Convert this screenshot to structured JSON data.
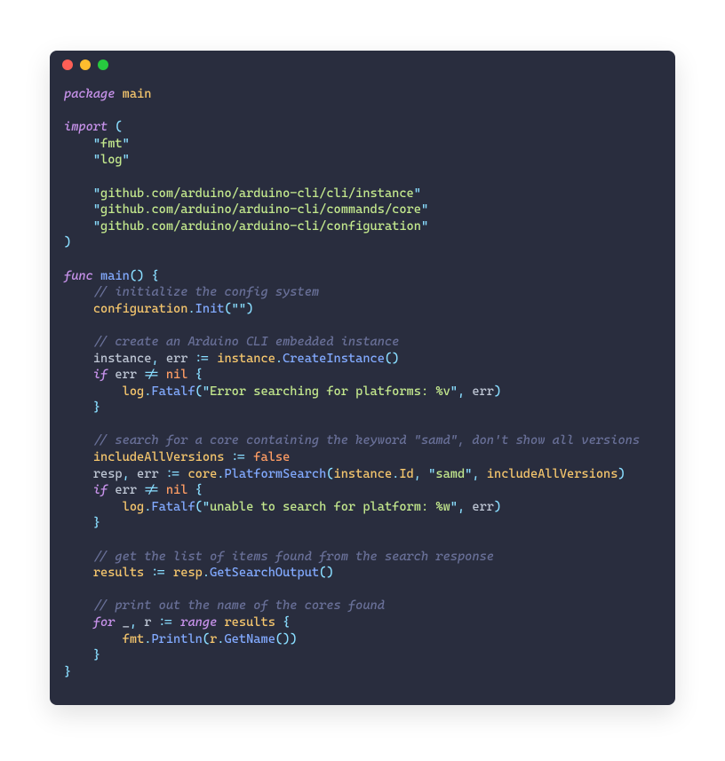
{
  "lines": [
    [
      [
        "kw-pkg",
        "package"
      ],
      [
        "white",
        " "
      ],
      [
        "ident",
        "main"
      ]
    ],
    [],
    [
      [
        "kw-pkg",
        "import"
      ],
      [
        "white",
        " "
      ],
      [
        "punc",
        "("
      ]
    ],
    [
      [
        "white",
        "    "
      ],
      [
        "strq",
        "\""
      ],
      [
        "str",
        "fmt"
      ],
      [
        "strq",
        "\""
      ]
    ],
    [
      [
        "white",
        "    "
      ],
      [
        "strq",
        "\""
      ],
      [
        "str",
        "log"
      ],
      [
        "strq",
        "\""
      ]
    ],
    [],
    [
      [
        "white",
        "    "
      ],
      [
        "strq",
        "\""
      ],
      [
        "str",
        "github.com/arduino/arduino-cli/cli/instance"
      ],
      [
        "strq",
        "\""
      ]
    ],
    [
      [
        "white",
        "    "
      ],
      [
        "strq",
        "\""
      ],
      [
        "str",
        "github.com/arduino/arduino-cli/commands/core"
      ],
      [
        "strq",
        "\""
      ]
    ],
    [
      [
        "white",
        "    "
      ],
      [
        "strq",
        "\""
      ],
      [
        "str",
        "github.com/arduino/arduino-cli/configuration"
      ],
      [
        "strq",
        "\""
      ]
    ],
    [
      [
        "punc",
        ")"
      ]
    ],
    [],
    [
      [
        "kw-pkg",
        "func"
      ],
      [
        "white",
        " "
      ],
      [
        "call",
        "main"
      ],
      [
        "punc",
        "()"
      ],
      [
        "white",
        " "
      ],
      [
        "punc",
        "{"
      ]
    ],
    [
      [
        "white",
        "    "
      ],
      [
        "comment",
        "// initialize the config system"
      ]
    ],
    [
      [
        "white",
        "    "
      ],
      [
        "ident",
        "configuration"
      ],
      [
        "punc",
        "."
      ],
      [
        "call",
        "Init"
      ],
      [
        "punc",
        "("
      ],
      [
        "strq",
        "\""
      ],
      [
        "strq",
        "\""
      ],
      [
        "punc",
        ")"
      ]
    ],
    [],
    [
      [
        "white",
        "    "
      ],
      [
        "comment",
        "// create an Arduino CLI embedded instance"
      ]
    ],
    [
      [
        "white",
        "    "
      ],
      [
        "varname",
        "instance"
      ],
      [
        "punc",
        ","
      ],
      [
        "white",
        " "
      ],
      [
        "varname",
        "err"
      ],
      [
        "white",
        " "
      ],
      [
        "punc",
        ":="
      ],
      [
        "white",
        " "
      ],
      [
        "ident",
        "instance"
      ],
      [
        "punc",
        "."
      ],
      [
        "call",
        "CreateInstance"
      ],
      [
        "punc",
        "()"
      ]
    ],
    [
      [
        "white",
        "    "
      ],
      [
        "kw-pkg",
        "if"
      ],
      [
        "white",
        " "
      ],
      [
        "varname",
        "err"
      ],
      [
        "white",
        " "
      ],
      [
        "punc",
        "!="
      ],
      [
        "white",
        " "
      ],
      [
        "const",
        "nil"
      ],
      [
        "white",
        " "
      ],
      [
        "punc",
        "{"
      ]
    ],
    [
      [
        "white",
        "        "
      ],
      [
        "ident",
        "log"
      ],
      [
        "punc",
        "."
      ],
      [
        "call",
        "Fatalf"
      ],
      [
        "punc",
        "("
      ],
      [
        "strq",
        "\""
      ],
      [
        "str",
        "Error searching for platforms: %v"
      ],
      [
        "strq",
        "\""
      ],
      [
        "punc",
        ","
      ],
      [
        "white",
        " "
      ],
      [
        "varname",
        "err"
      ],
      [
        "punc",
        ")"
      ]
    ],
    [
      [
        "white",
        "    "
      ],
      [
        "punc",
        "}"
      ]
    ],
    [],
    [
      [
        "white",
        "    "
      ],
      [
        "comment",
        "// search for a core containing the keyword \"samd\", don't show all versions"
      ]
    ],
    [
      [
        "white",
        "    "
      ],
      [
        "ident",
        "includeAllVersions"
      ],
      [
        "white",
        " "
      ],
      [
        "punc",
        ":="
      ],
      [
        "white",
        " "
      ],
      [
        "const",
        "false"
      ]
    ],
    [
      [
        "white",
        "    "
      ],
      [
        "varname",
        "resp"
      ],
      [
        "punc",
        ","
      ],
      [
        "white",
        " "
      ],
      [
        "varname",
        "err"
      ],
      [
        "white",
        " "
      ],
      [
        "punc",
        ":="
      ],
      [
        "white",
        " "
      ],
      [
        "ident",
        "core"
      ],
      [
        "punc",
        "."
      ],
      [
        "call",
        "PlatformSearch"
      ],
      [
        "punc",
        "("
      ],
      [
        "ident",
        "instance"
      ],
      [
        "punc",
        "."
      ],
      [
        "ident",
        "Id"
      ],
      [
        "punc",
        ","
      ],
      [
        "white",
        " "
      ],
      [
        "strq",
        "\""
      ],
      [
        "str",
        "samd"
      ],
      [
        "strq",
        "\""
      ],
      [
        "punc",
        ","
      ],
      [
        "white",
        " "
      ],
      [
        "ident",
        "includeAllVersions"
      ],
      [
        "punc",
        ")"
      ]
    ],
    [
      [
        "white",
        "    "
      ],
      [
        "kw-pkg",
        "if"
      ],
      [
        "white",
        " "
      ],
      [
        "varname",
        "err"
      ],
      [
        "white",
        " "
      ],
      [
        "punc",
        "!="
      ],
      [
        "white",
        " "
      ],
      [
        "const",
        "nil"
      ],
      [
        "white",
        " "
      ],
      [
        "punc",
        "{"
      ]
    ],
    [
      [
        "white",
        "        "
      ],
      [
        "ident",
        "log"
      ],
      [
        "punc",
        "."
      ],
      [
        "call",
        "Fatalf"
      ],
      [
        "punc",
        "("
      ],
      [
        "strq",
        "\""
      ],
      [
        "str",
        "unable to search for platform: %w"
      ],
      [
        "strq",
        "\""
      ],
      [
        "punc",
        ","
      ],
      [
        "white",
        " "
      ],
      [
        "varname",
        "err"
      ],
      [
        "punc",
        ")"
      ]
    ],
    [
      [
        "white",
        "    "
      ],
      [
        "punc",
        "}"
      ]
    ],
    [],
    [
      [
        "white",
        "    "
      ],
      [
        "comment",
        "// get the list of items found from the search response"
      ]
    ],
    [
      [
        "white",
        "    "
      ],
      [
        "ident",
        "results"
      ],
      [
        "white",
        " "
      ],
      [
        "punc",
        ":="
      ],
      [
        "white",
        " "
      ],
      [
        "ident",
        "resp"
      ],
      [
        "punc",
        "."
      ],
      [
        "call",
        "GetSearchOutput"
      ],
      [
        "punc",
        "()"
      ]
    ],
    [],
    [
      [
        "white",
        "    "
      ],
      [
        "comment",
        "// print out the name of the cores found"
      ]
    ],
    [
      [
        "white",
        "    "
      ],
      [
        "kw-pkg",
        "for"
      ],
      [
        "white",
        " "
      ],
      [
        "varname",
        "_"
      ],
      [
        "punc",
        ","
      ],
      [
        "white",
        " "
      ],
      [
        "varname",
        "r"
      ],
      [
        "white",
        " "
      ],
      [
        "punc",
        ":="
      ],
      [
        "white",
        " "
      ],
      [
        "kw-pkg",
        "range"
      ],
      [
        "white",
        " "
      ],
      [
        "ident",
        "results"
      ],
      [
        "white",
        " "
      ],
      [
        "punc",
        "{"
      ]
    ],
    [
      [
        "white",
        "        "
      ],
      [
        "ident",
        "fmt"
      ],
      [
        "punc",
        "."
      ],
      [
        "call",
        "Println"
      ],
      [
        "punc",
        "("
      ],
      [
        "ident",
        "r"
      ],
      [
        "punc",
        "."
      ],
      [
        "call",
        "GetName"
      ],
      [
        "punc",
        "())"
      ]
    ],
    [
      [
        "white",
        "    "
      ],
      [
        "punc",
        "}"
      ]
    ],
    [
      [
        "punc",
        "}"
      ]
    ]
  ]
}
